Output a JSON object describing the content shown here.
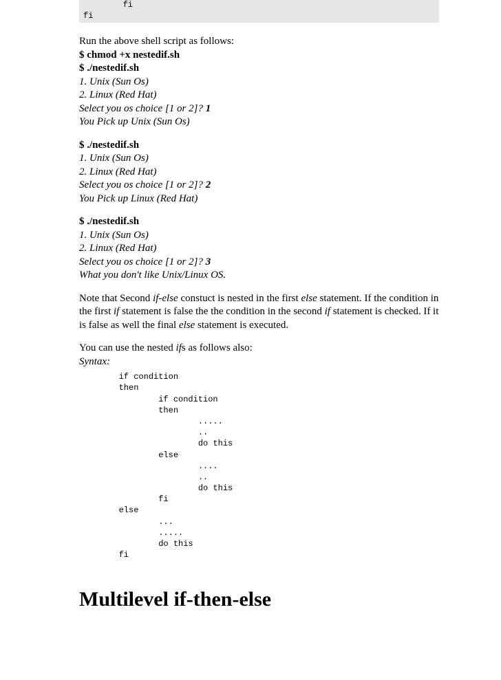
{
  "code_top": "        fi\nfi",
  "intro": "Run the above shell script as follows:",
  "run1": {
    "cmd1": "$ chmod +x nestedif.sh",
    "cmd2": "$ ./nestedif.sh",
    "l1": "1. Unix (Sun Os)",
    "l2": "2. Linux (Red Hat)",
    "prompt": "Select you os choice [1 or 2]? ",
    "input": "1",
    "result": "You Pick up Unix (Sun Os)"
  },
  "run2": {
    "cmd": "$ ./nestedif.sh",
    "l1": "1. Unix (Sun Os)",
    "l2": "2. Linux (Red Hat)",
    "prompt": "Select you os choice [1 or 2]? ",
    "input": "2",
    "result": "You Pick up Linux (Red Hat)"
  },
  "run3": {
    "cmd": "$ ./nestedif.sh",
    "l1": "1. Unix (Sun Os)",
    "l2": "2. Linux (Red Hat)",
    "prompt": "Select you os choice [1 or 2]? ",
    "input": "3",
    "result": "What you don't like Unix/Linux OS."
  },
  "note": {
    "t1": "Note that Second ",
    "i1": "if-else",
    "t2": " constuct is nested in the first ",
    "i2": "else",
    "t3": " statement. If the condition in the first ",
    "i3": "if",
    "t4": " statement is false the the condition in the second ",
    "i4": "if",
    "t5": " statement is checked. If it is false as well the final ",
    "i5": "else",
    "t6": " statement is executed."
  },
  "nested_intro": {
    "t1": "You can use the nested ",
    "i1": "if",
    "t2": "s as follows also:"
  },
  "syntax_label": "Syntax:",
  "syntax_block": "        if condition\n        then\n                if condition\n                then\n                        .....\n                        ..\n                        do this\n                else\n                        ....\n                        ..\n                        do this\n                fi\n        else\n                ...\n                .....\n                do this\n        fi",
  "heading": "Multilevel if-then-else"
}
